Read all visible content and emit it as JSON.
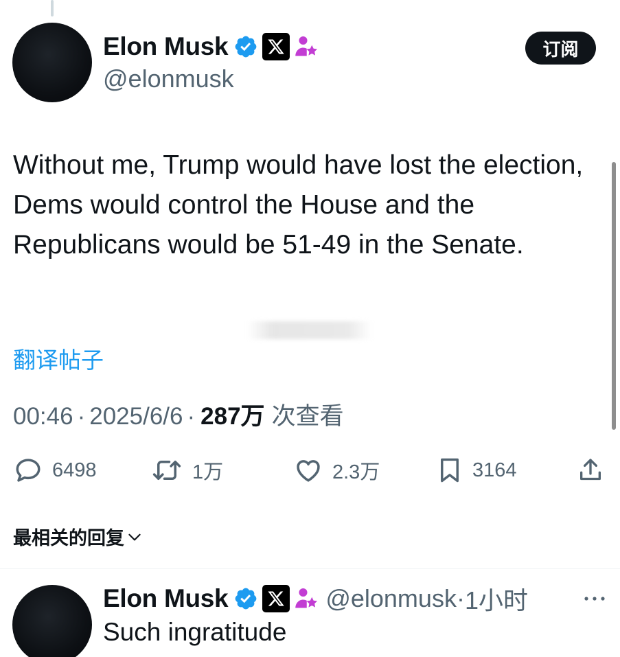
{
  "subscribe_label": "订阅",
  "main_post": {
    "display_name": "Elon Musk",
    "handle": "@elonmusk",
    "text": "Without me, Trump would have lost the election, Dems would control the House and the Republicans would be 51-49 in the Senate.",
    "translate_label": "翻译帖子",
    "time": "00:46",
    "separator": "·",
    "date": "2025/6/6",
    "views_count": "287万",
    "views_label": "次查看"
  },
  "actions": {
    "replies": "6498",
    "reposts": "1万",
    "likes": "2.3万",
    "bookmarks": "3164"
  },
  "sort_label": "最相关的回复",
  "reply_post": {
    "display_name": "Elon Musk",
    "handle": "@elonmusk",
    "separator": "·",
    "time_ago": "1小时",
    "text": "Such ingratitude"
  },
  "colors": {
    "verified": "#1d9bf0",
    "affiliate": "#c23dd3",
    "link": "#1d9bf0",
    "secondary_text": "#536471"
  },
  "icons": [
    "verified-badge-icon",
    "x-affiliation-icon",
    "affiliate-person-star-icon",
    "reply-icon",
    "retweet-icon",
    "like-icon",
    "bookmark-icon",
    "share-icon",
    "chevron-down-icon",
    "more-icon"
  ]
}
